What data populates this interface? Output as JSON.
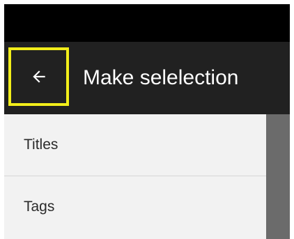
{
  "toolbar": {
    "title": "Make selelection",
    "back_icon": "arrow-left-icon"
  },
  "list": {
    "items": [
      {
        "label": "Titles"
      },
      {
        "label": "Tags"
      }
    ]
  },
  "colors": {
    "status_bar": "#000000",
    "toolbar": "#212121",
    "highlight": "#f2ee1a",
    "list_background": "#f2f2f2",
    "scrim": "#6b6b6b"
  }
}
